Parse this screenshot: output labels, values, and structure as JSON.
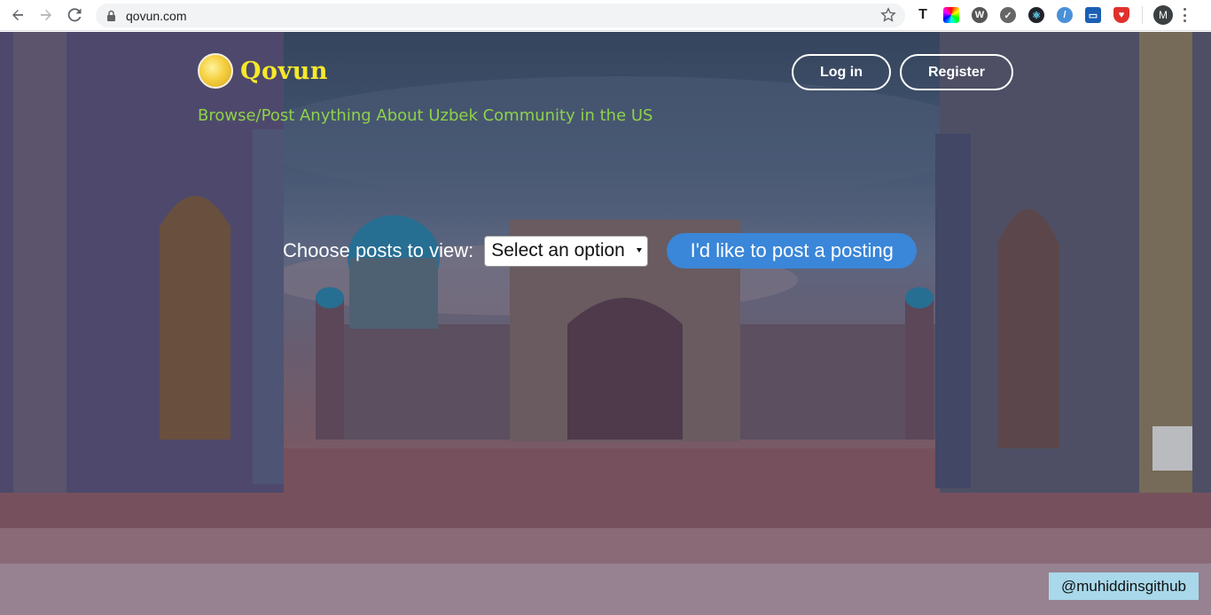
{
  "browser": {
    "url": "qovun.com",
    "profile_initial": "M"
  },
  "site": {
    "name": "Qovun",
    "tagline": "Browse/Post Anything About Uzbek Community in the US"
  },
  "header": {
    "login_label": "Log in",
    "register_label": "Register"
  },
  "chooser": {
    "label": "Choose posts to view:",
    "select_value": "Select an option",
    "post_button_label": "I'd like to post a posting"
  },
  "watermark": "@muhiddinsgithub",
  "colors": {
    "brand_yellow": "#f6e82a",
    "tagline_green": "#8ed14a",
    "post_button_blue": "#3a86d8",
    "watermark_bg": "#a8d8ea"
  },
  "icons": [
    "back-icon",
    "forward-icon",
    "reload-icon",
    "lock-icon",
    "bookmark-star-icon",
    "extension-icons",
    "menu-icon"
  ]
}
